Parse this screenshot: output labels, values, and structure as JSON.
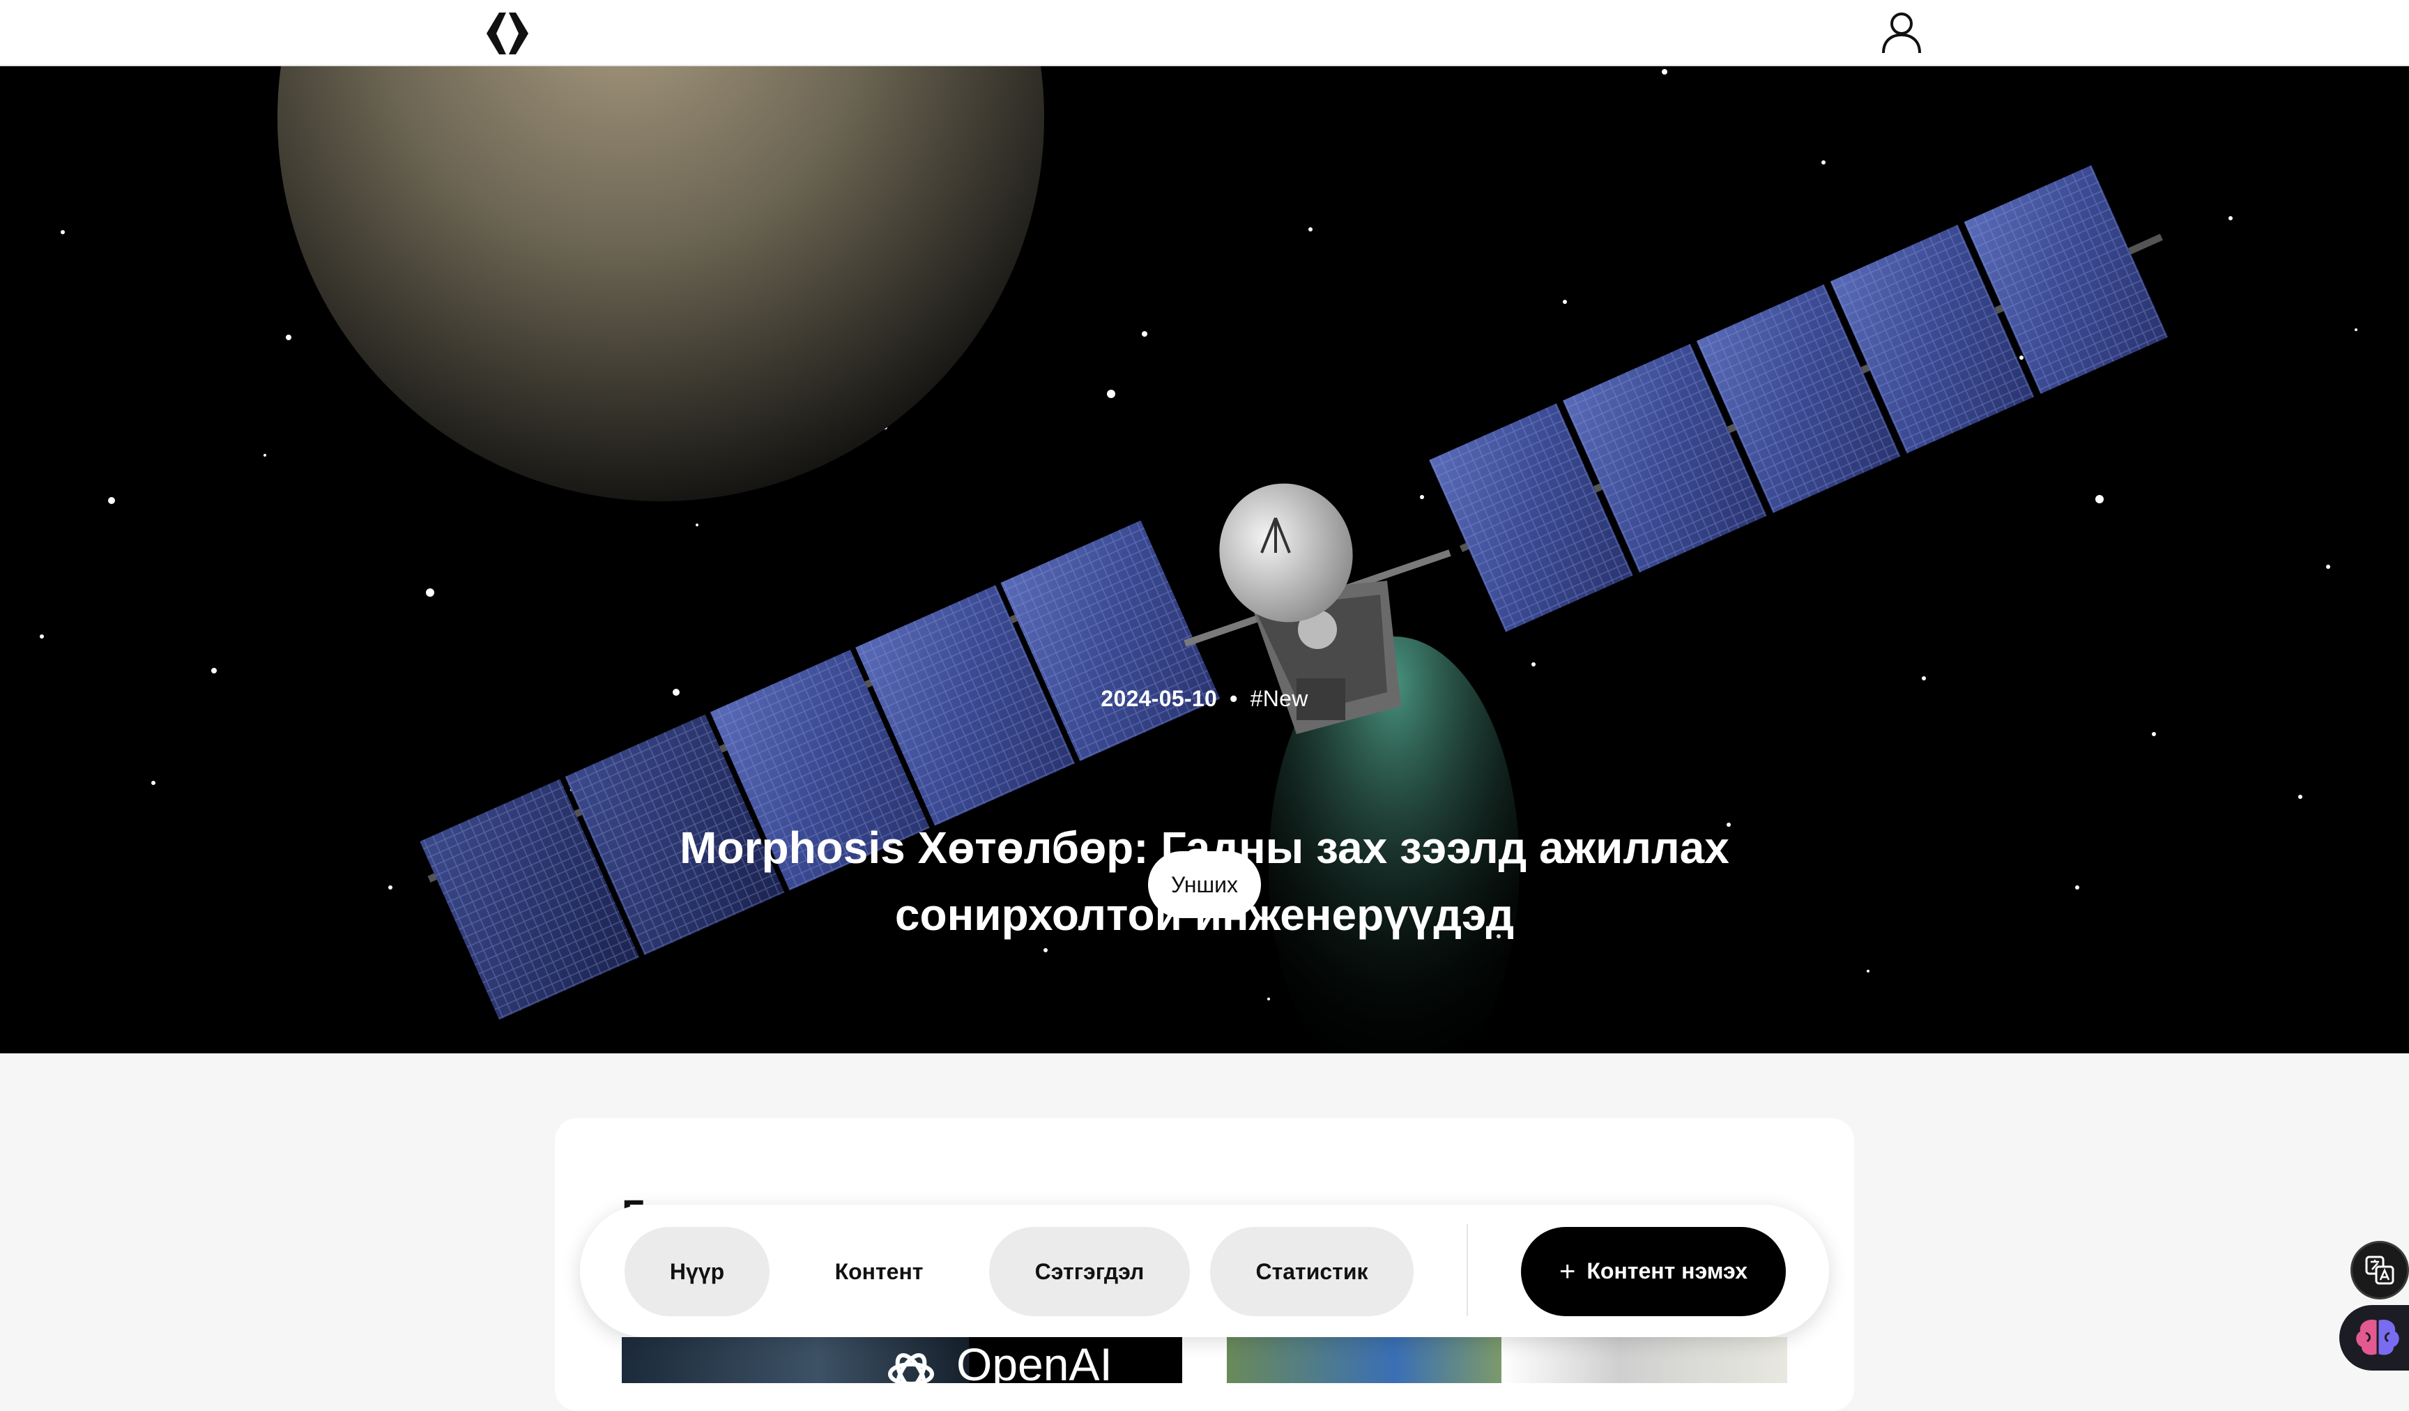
{
  "header": {
    "logo_icon": "brackets-logo-icon",
    "user_icon": "user-icon"
  },
  "hero": {
    "date": "2024-05-10",
    "separator": "•",
    "tag": "#New",
    "title": "Morphosis Хөтөлбөр: Гадны зах зээлд ажиллах сонирхолтой инженерүүдэд",
    "read_button": "Унших",
    "image": "satellite-near-planet"
  },
  "content_card": {
    "heading": "Г"
  },
  "thumbnails": [
    {
      "icon": "openai-logo-icon",
      "text": "OpenAI"
    },
    {
      "icon": "robot-vehicles-image"
    }
  ],
  "navbar": {
    "items": [
      {
        "label": "Нүүр"
      },
      {
        "label": "Контент"
      },
      {
        "label": "Сэтгэгдэл"
      },
      {
        "label": "Статистик"
      }
    ],
    "add_button": {
      "label": "Контент нэмэх",
      "icon": "plus-icon"
    }
  },
  "widgets": {
    "translate_icon": "translate-icon",
    "assistant_icon": "brain-icon"
  },
  "colors": {
    "background": "#f6f6f6",
    "hero_background": "#000000",
    "nav_pill": "#ebebeb",
    "primary_button": "#000000",
    "solar_panel": "#3f4f9a"
  }
}
